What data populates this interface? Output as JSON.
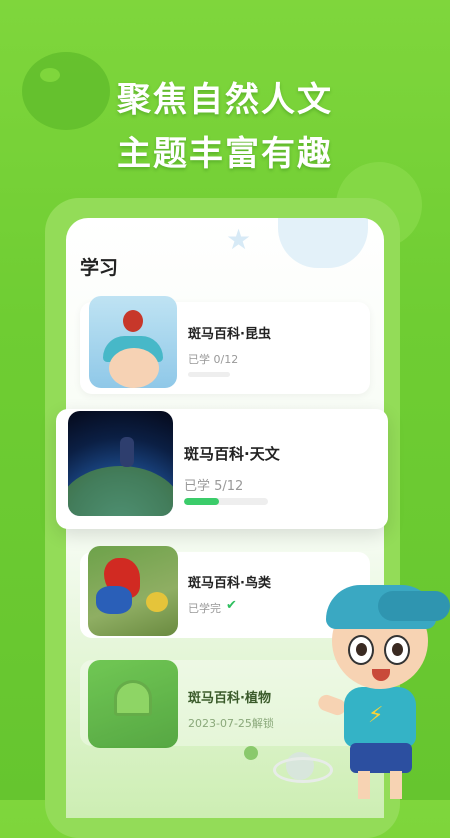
{
  "hero": {
    "line1": "聚焦自然人文",
    "line2": "主题丰富有趣"
  },
  "screen": {
    "section_title": "学习",
    "courses": [
      {
        "name": "斑马百科·昆虫",
        "progress_label": "已学 0/12",
        "progress": 0.0
      },
      {
        "name": "斑马百科·天文",
        "progress_label": "已学 5/12",
        "progress": 0.4167
      },
      {
        "name": "斑马百科·鸟类",
        "progress_label": "已学完",
        "status_icon": "check-icon"
      },
      {
        "name": "斑马百科·植物",
        "progress_label": "2023-07-25解锁",
        "locked": true
      }
    ]
  },
  "colors": {
    "background": "#6fcd33",
    "accent_progress": "#3bcc6a",
    "check": "#2fbf5f"
  },
  "icons": {
    "course_complete": "check-icon",
    "mascot_shirt": "lightning-bolt-icon"
  }
}
